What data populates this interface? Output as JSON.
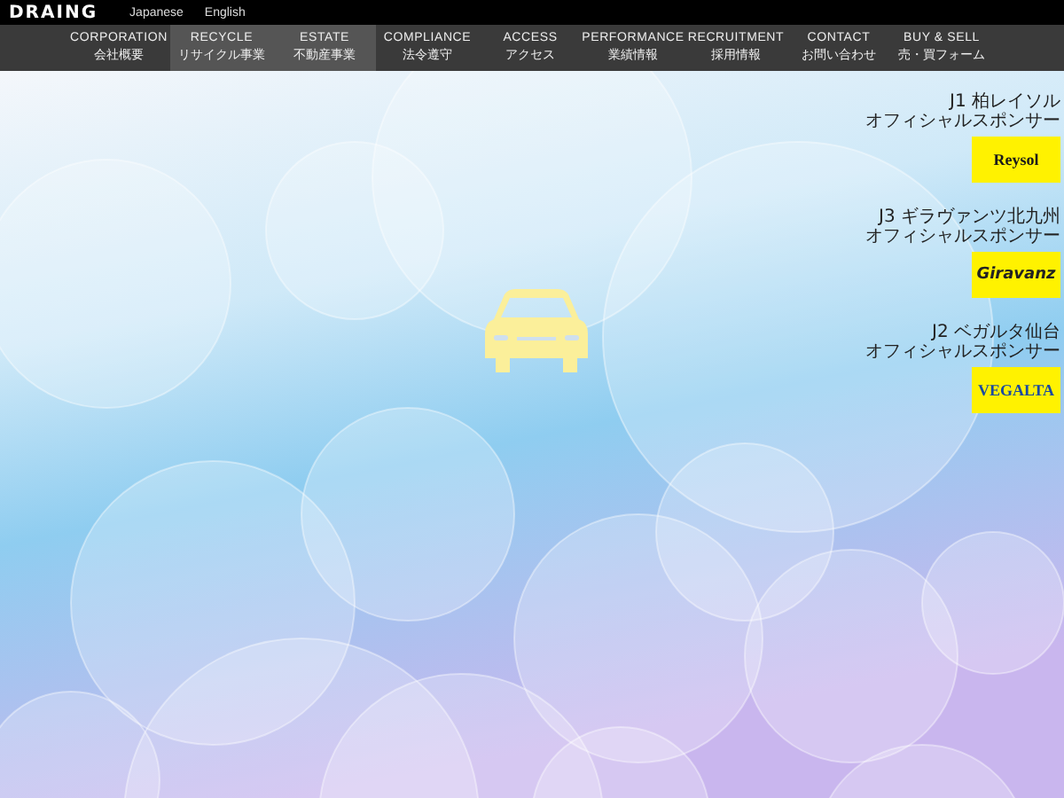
{
  "logo": "DRAING",
  "languages": [
    {
      "label": "Japanese"
    },
    {
      "label": "English"
    }
  ],
  "nav": [
    {
      "en": "CORPORATION",
      "ja": "会社概要",
      "selected": false
    },
    {
      "en": "RECYCLE",
      "ja": "リサイクル事業",
      "selected": true
    },
    {
      "en": "ESTATE",
      "ja": "不動産事業",
      "selected": true
    },
    {
      "en": "COMPLIANCE",
      "ja": "法令遵守",
      "selected": false
    },
    {
      "en": "ACCESS",
      "ja": "アクセス",
      "selected": false
    },
    {
      "en": "PERFORMANCE",
      "ja": "業績情報",
      "selected": false
    },
    {
      "en": "RECRUITMENT",
      "ja": "採用情報",
      "selected": false
    },
    {
      "en": "CONTACT",
      "ja": "お問い合わせ",
      "selected": false
    },
    {
      "en": "BUY & SELL",
      "ja": "売・買フォーム",
      "selected": false
    }
  ],
  "sponsors": [
    {
      "line1": "J1 柏レイソル",
      "line2": "オフィシャルスポンサー",
      "logo": "Reysol",
      "kind": "reysol"
    },
    {
      "line1": "J3 ギラヴァンツ北九州",
      "line2": "オフィシャルスポンサー",
      "logo": "Giravanz",
      "kind": "giravanz"
    },
    {
      "line1": "J2 ベガルタ仙台",
      "line2": "オフィシャルスポンサー",
      "logo": "VEGALTA",
      "kind": "vegalta"
    }
  ]
}
